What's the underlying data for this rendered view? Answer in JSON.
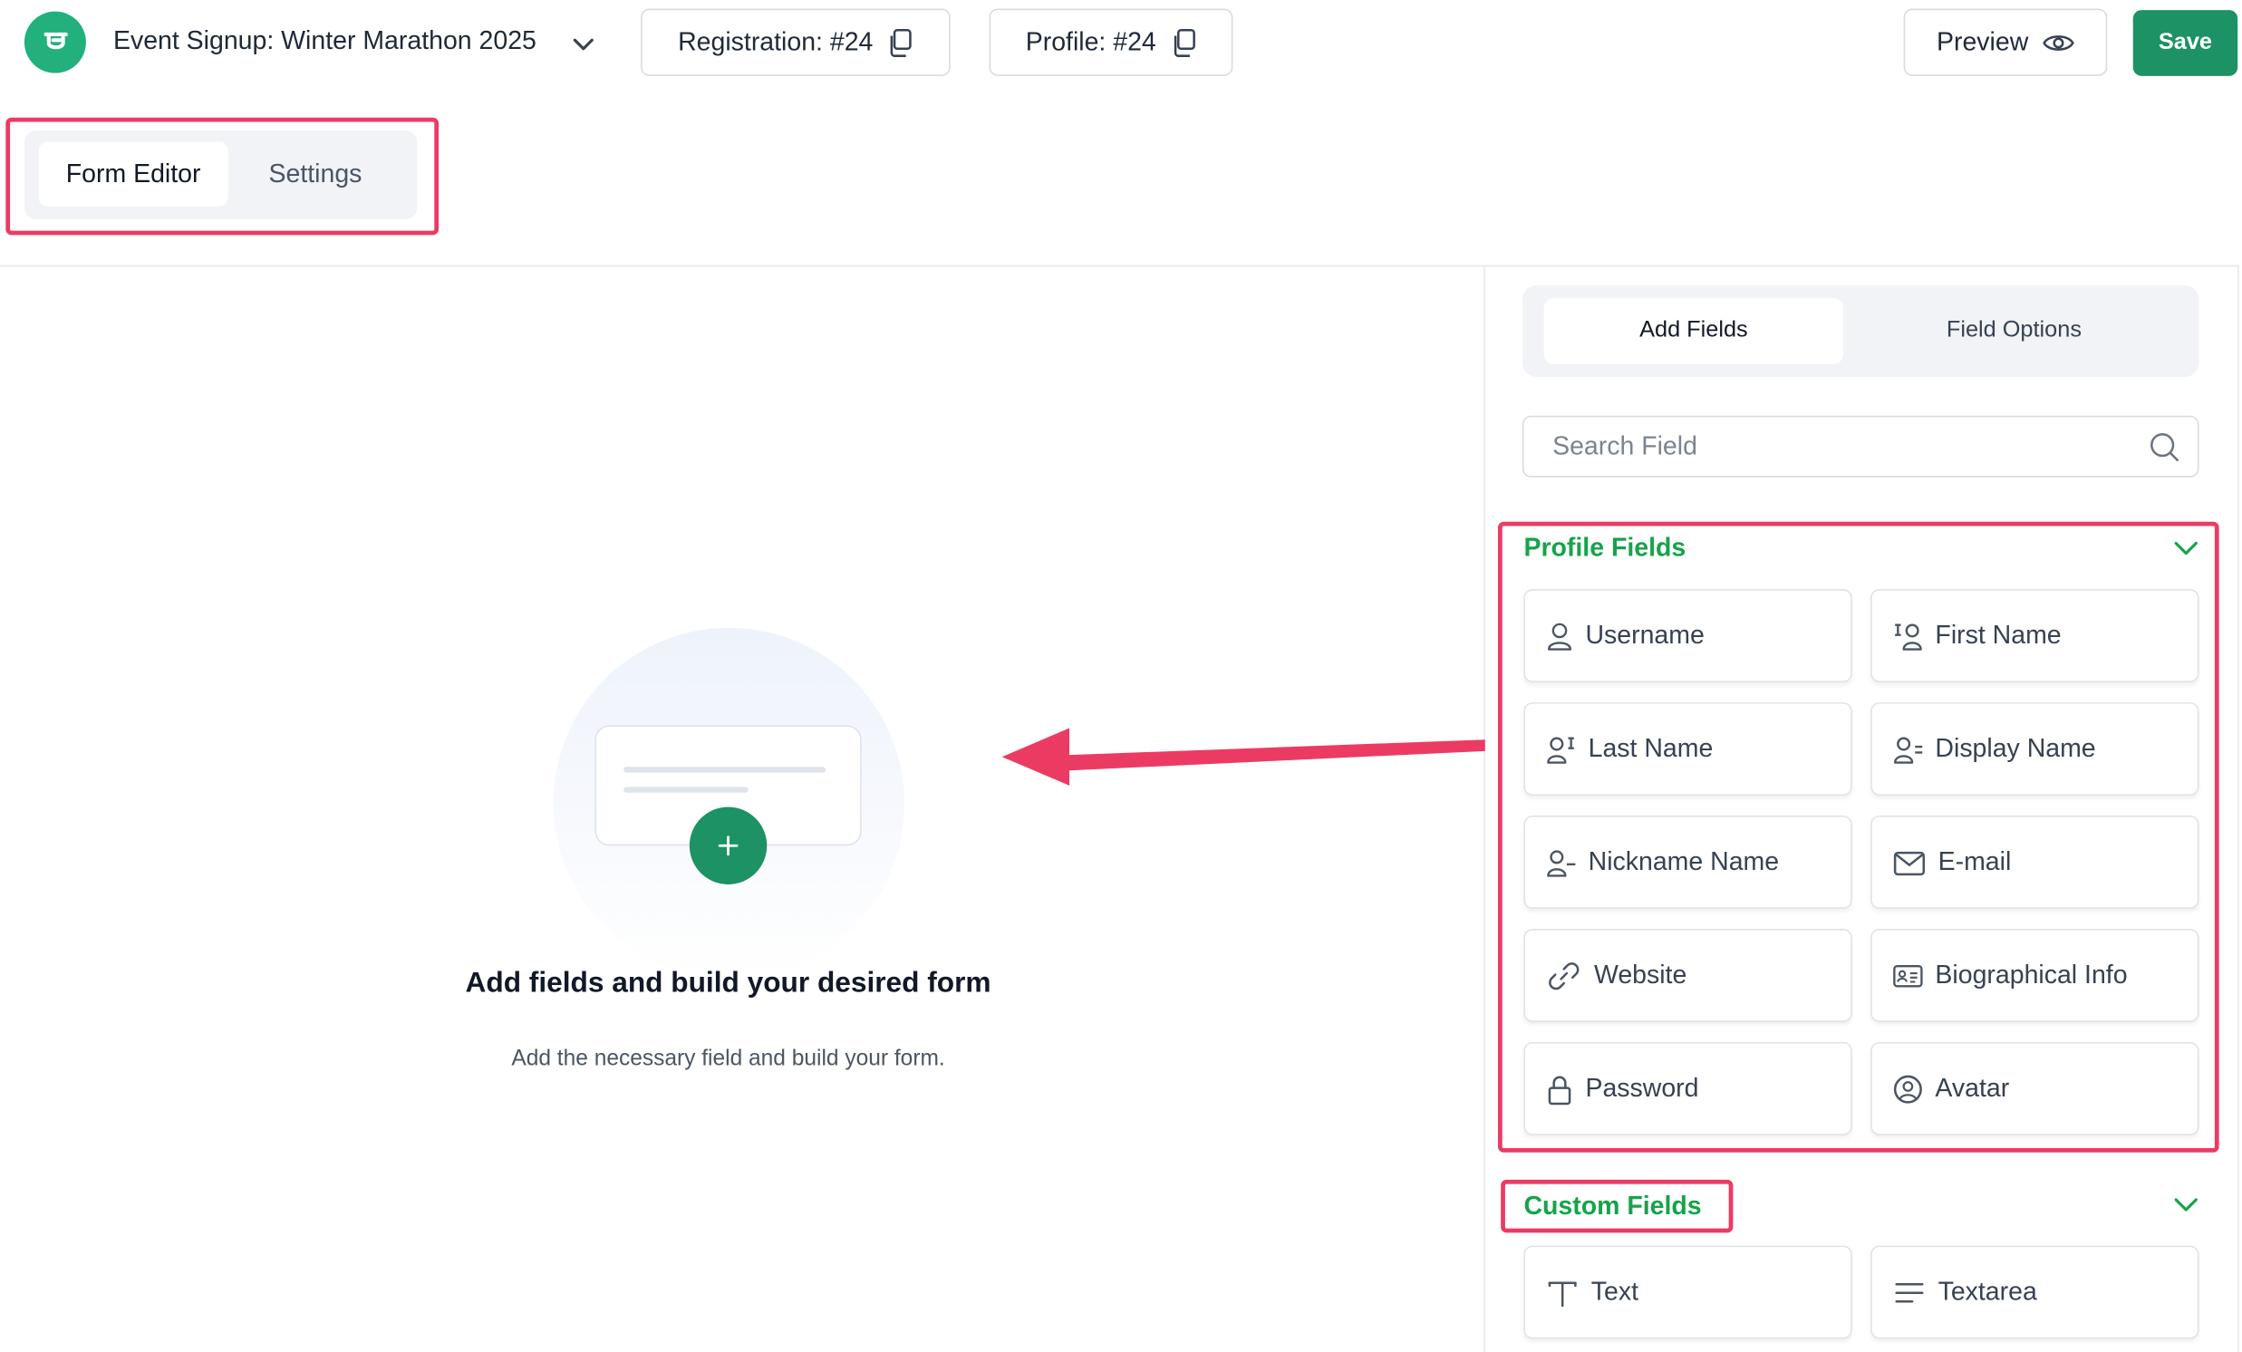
{
  "header": {
    "form_title": "Event Signup: Winter Marathon 2025",
    "registration_label": "Registration: #24",
    "profile_label": "Profile: #24",
    "preview_label": "Preview",
    "save_label": "Save"
  },
  "tabs": [
    {
      "label": "Form Editor",
      "active": true
    },
    {
      "label": "Settings",
      "active": false
    }
  ],
  "canvas": {
    "empty_title": "Add fields and build your desired form",
    "empty_subtitle": "Add the necessary field and build your form."
  },
  "panel": {
    "tabs": [
      {
        "label": "Add Fields",
        "active": true
      },
      {
        "label": "Field Options",
        "active": false
      }
    ],
    "search_placeholder": "Search Field",
    "sections": [
      {
        "title": "Profile Fields",
        "fields": [
          {
            "label": "Username",
            "icon": "user-icon"
          },
          {
            "label": "First Name",
            "icon": "first-name-icon"
          },
          {
            "label": "Last Name",
            "icon": "last-name-icon"
          },
          {
            "label": "Display Name",
            "icon": "display-name-icon"
          },
          {
            "label": "Nickname Name",
            "icon": "nickname-icon"
          },
          {
            "label": "E-mail",
            "icon": "mail-icon"
          },
          {
            "label": "Website",
            "icon": "link-icon"
          },
          {
            "label": "Biographical Info",
            "icon": "id-card-icon"
          },
          {
            "label": "Password",
            "icon": "lock-icon"
          },
          {
            "label": "Avatar",
            "icon": "avatar-icon"
          }
        ]
      },
      {
        "title": "Custom Fields",
        "fields": [
          {
            "label": "Text",
            "icon": "text-icon"
          },
          {
            "label": "Textarea",
            "icon": "textarea-icon"
          }
        ]
      }
    ]
  },
  "colors": {
    "accent_green": "#1d9264",
    "section_green": "#16a34a",
    "annotation_red": "#ec3b63"
  }
}
